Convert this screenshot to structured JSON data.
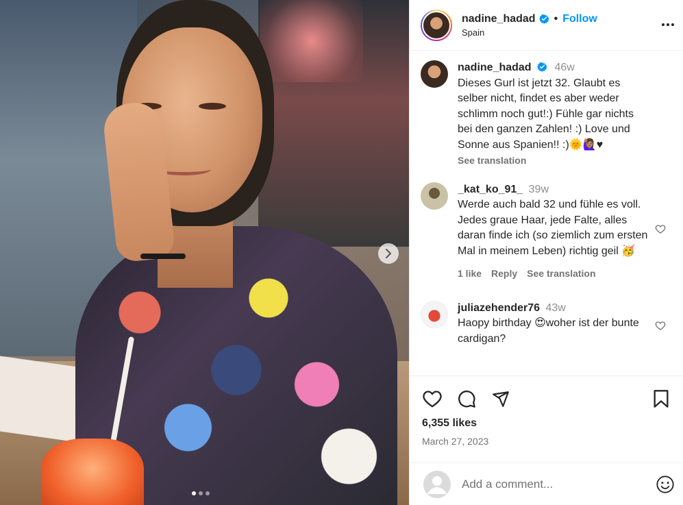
{
  "post": {
    "author": "nadine_hadad",
    "location": "Spain",
    "follow_label": "Follow",
    "separator": "•"
  },
  "photo": {
    "icon": "chevron-right-icon",
    "carousel_dots": 3,
    "active_dot": 1
  },
  "comments": [
    {
      "user": "nadine_hadad",
      "verified": true,
      "age": "46w",
      "text": "Dieses Gurl ist jetzt 32. Glaubt es selber nicht, findet es aber weder schlimm noch gut!:) Fühle gar nichts bei den ganzen Zahlen! :) Love und Sonne aus Spanien!! :)🌞🙋🏽‍♀️♥",
      "see_translation": "See translation"
    },
    {
      "user": "_kat_ko_91_",
      "age": "39w",
      "text": "Werde auch bald 32 und fühle es voll. Jedes graue Haar, jede Falte, alles daran finde ich (so ziemlich zum ersten Mal in meinem Leben) richtig geil 🥳",
      "likes": "1 like",
      "reply": "Reply",
      "see_translation": "See translation"
    },
    {
      "user": "juliazehender76",
      "age": "43w",
      "text": "Haopy birthday 😍woher ist der bunte cardigan?"
    }
  ],
  "actions": {
    "icons": [
      "heart-icon",
      "comment-icon",
      "share-icon",
      "bookmark-icon"
    ],
    "likes": "6,355 likes",
    "date": "March 27, 2023"
  },
  "add_comment": {
    "placeholder": "Add a comment...",
    "emoji_icon": "emoji-icon"
  },
  "colors": {
    "accent": "#0095f6",
    "muted": "#737373",
    "border": "#efefef"
  }
}
